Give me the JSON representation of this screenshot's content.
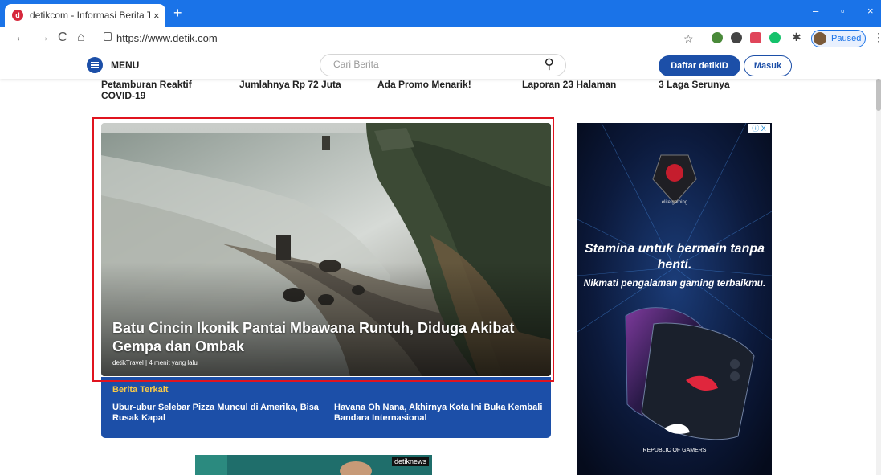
{
  "browser": {
    "tab_title": "detikcom - Informasi Berita Terki",
    "tab_close": "×",
    "new_tab": "+",
    "url": "https://www.detik.com",
    "profile_label": "Paused",
    "window_controls": [
      "–",
      "▫",
      "×"
    ]
  },
  "header": {
    "menu_label": "MENU",
    "search_placeholder": "Cari Berita",
    "register_label": "Daftar detikID",
    "login_label": "Masuk"
  },
  "top_headlines": [
    {
      "text": "Petamburan Reaktif COVID-19"
    },
    {
      "text": "Jumlahnya Rp 72 Juta"
    },
    {
      "text": "Ada Promo Menarik!"
    },
    {
      "text": "Laporan 23 Halaman"
    },
    {
      "text": "3 Laga Serunya"
    }
  ],
  "hero": {
    "title": "Batu Cincin Ikonik Pantai Mbawana Runtuh, Diduga Akibat Gempa dan Ombak",
    "meta": "detikTravel | 4 menit yang lalu"
  },
  "related": {
    "heading": "Berita Terkait",
    "items": [
      "Ubur-ubur Selebar Pizza Muncul di Amerika, Bisa Rusak Kapal",
      "Havana Oh Nana, Akhirnya Kota Ini Buka Kembali Bandara Internasional"
    ]
  },
  "ad": {
    "line1": "Stamina untuk bermain tanpa henti.",
    "line2": "Nikmati pengalaman gaming terbaikmu.",
    "badge": "ⓘ X",
    "brand_text": "REPUBLIC OF GAMERS",
    "chip_text": "elite gaming"
  },
  "thumbnail": {
    "brand": "detiknews"
  },
  "colors": {
    "chrome_blue": "#1a73e8",
    "detik_blue": "#1c4fa8",
    "highlight_red": "#e0141f",
    "related_yellow": "#f7c948"
  }
}
